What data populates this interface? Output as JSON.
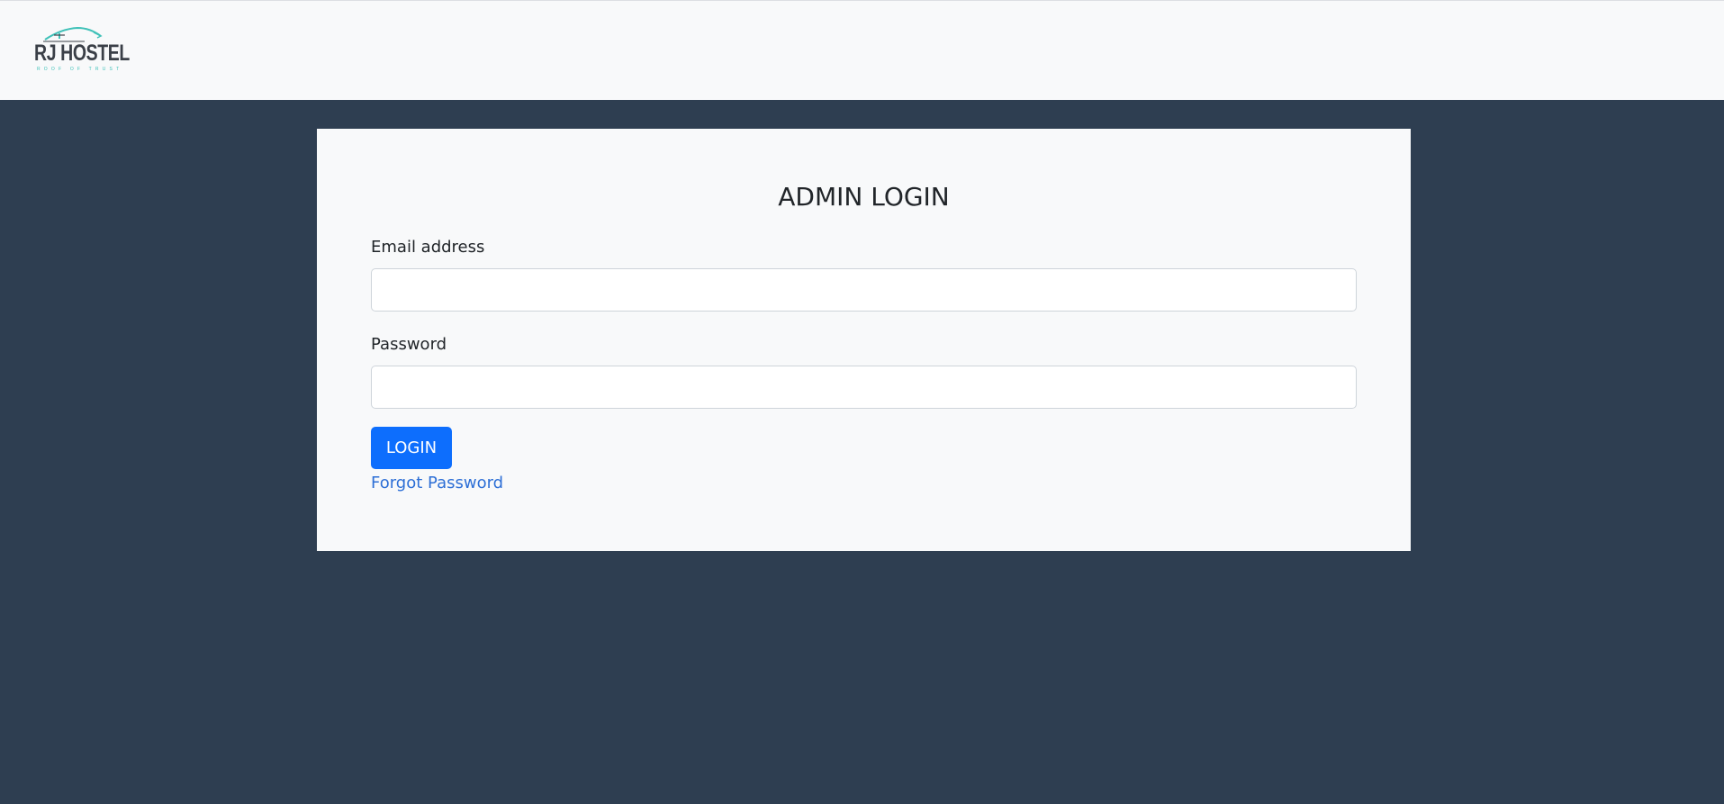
{
  "brand": {
    "name": "RJ HOSTEL",
    "tagline": "ROOF OF TRUST",
    "accent_color": "#3fc1b8",
    "text_color": "#3a3f47"
  },
  "login": {
    "title": "ADMIN LOGIN",
    "email_label": "Email address",
    "email_value": "",
    "email_placeholder": "",
    "password_label": "Password",
    "password_value": "",
    "password_placeholder": "",
    "submit_label": "LOGIN",
    "forgot_label": "Forgot Password"
  },
  "colors": {
    "page_background": "#2e3e51",
    "navbar_background": "#f8f9fa",
    "card_background": "#f8f9fa",
    "primary_button": "#0d6efd",
    "link": "#2d6fd6"
  }
}
